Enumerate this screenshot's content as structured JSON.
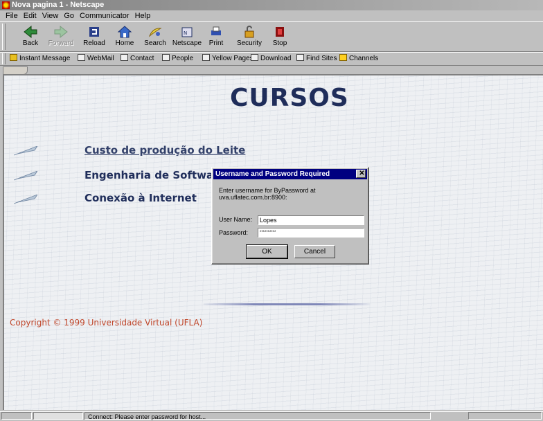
{
  "window": {
    "title": "Nova pagina 1 - Netscape"
  },
  "menu": [
    "File",
    "Edit",
    "View",
    "Go",
    "Communicator",
    "Help"
  ],
  "toolbar": [
    {
      "label": "Back",
      "icon": "back-arrow-icon",
      "enabled": true
    },
    {
      "label": "Forward",
      "icon": "forward-arrow-icon",
      "enabled": false
    },
    {
      "label": "Reload",
      "icon": "reload-icon",
      "enabled": true
    },
    {
      "label": "Home",
      "icon": "home-icon",
      "enabled": true
    },
    {
      "label": "Search",
      "icon": "search-icon",
      "enabled": true
    },
    {
      "label": "Netscape",
      "icon": "netscape-icon",
      "enabled": true
    },
    {
      "label": "Print",
      "icon": "print-icon",
      "enabled": true
    },
    {
      "label": "Security",
      "icon": "security-lock-icon",
      "enabled": true
    },
    {
      "label": "Stop",
      "icon": "stop-icon",
      "enabled": true
    }
  ],
  "links": [
    "Instant Message",
    "WebMail",
    "Contact",
    "People",
    "Yellow Pages",
    "Download",
    "Find Sites",
    "Channels"
  ],
  "page": {
    "heading": "CURSOS",
    "courses": [
      {
        "label": "Custo de produção do Leite",
        "is_link": true
      },
      {
        "label": "Engenharia de Softwar",
        "is_link": false
      },
      {
        "label": "Conexão à  Internet",
        "is_link": false
      }
    ],
    "copyright": "Copyright © 1999 Universidade Virtual (UFLA)"
  },
  "dialog": {
    "title": "Username and Password Required",
    "message": "Enter username for ByPassword at uva.uflatec.com.br:8900:",
    "username_label": "User Name:",
    "username_value": "Lopes",
    "password_label": "Password:",
    "password_value": "**********",
    "ok_label": "OK",
    "cancel_label": "Cancel"
  },
  "status": {
    "text": "Connect: Please enter password for host..."
  },
  "colors": {
    "heading": "#1f2d5a",
    "copyright": "#c0462a",
    "dialog_title": "#000080"
  }
}
